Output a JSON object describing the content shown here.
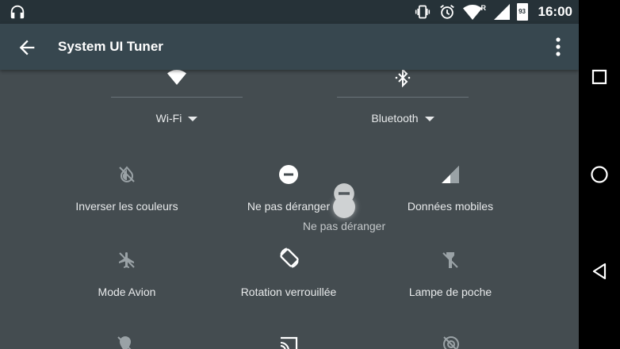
{
  "status_bar": {
    "time": "16:00",
    "battery_level": "93",
    "network_badge": "R",
    "icons": [
      "headphones-icon",
      "vibrate-icon",
      "alarm-icon",
      "wifi-icon",
      "signal-icon",
      "battery-icon"
    ]
  },
  "app_bar": {
    "title": "System UI Tuner",
    "back_icon": "arrow-back-icon",
    "menu_icon": "more-vert-icon"
  },
  "big_tiles": [
    {
      "label": "Wi-Fi",
      "icon": "wifi-icon"
    },
    {
      "label": "Bluetooth",
      "icon": "bluetooth-icon"
    }
  ],
  "tiles": [
    {
      "label": "Inverser les couleurs",
      "icon": "invert-colors-icon"
    },
    {
      "label": "Ne pas déranger",
      "icon": "do-not-disturb-icon"
    },
    {
      "label": "Données mobiles",
      "icon": "mobile-data-icon"
    },
    {
      "label": "Mode Avion",
      "icon": "airplane-icon"
    },
    {
      "label": "Rotation verrouillée",
      "icon": "rotation-lock-icon"
    },
    {
      "label": "Lampe de poche",
      "icon": "flashlight-icon"
    }
  ],
  "dragging_tile": {
    "label": "Ne pas déranger",
    "icon": "do-not-disturb-icon"
  },
  "colors": {
    "status_bar": "#263238",
    "app_bar": "#37474f",
    "content": "#444c50",
    "nav_bar": "#000000"
  }
}
